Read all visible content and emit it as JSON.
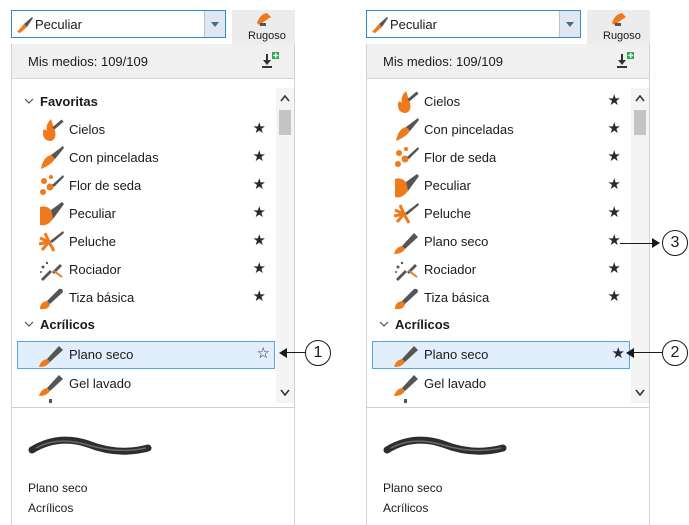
{
  "left": {
    "dropdown": "Peculiar",
    "next_tab": "Rugoso",
    "media_count": "Mis medios: 109/109",
    "groups": [
      {
        "label": "Favoritas",
        "items": [
          {
            "label": "Cielos",
            "icon": "brush-cielos",
            "starred": "★"
          },
          {
            "label": "Con pinceladas",
            "icon": "brush-pinceladas",
            "starred": "★"
          },
          {
            "label": "Flor de seda",
            "icon": "brush-flor",
            "starred": "★"
          },
          {
            "label": "Peculiar",
            "icon": "brush-peculiar",
            "starred": "★"
          },
          {
            "label": "Peluche",
            "icon": "brush-peluche",
            "starred": "★"
          },
          {
            "label": "Rociador",
            "icon": "brush-rociador",
            "starred": "★"
          },
          {
            "label": "Tiza básica",
            "icon": "brush-tiza",
            "starred": "★"
          }
        ]
      },
      {
        "label": "Acrílicos",
        "items": [
          {
            "label": "Plano seco",
            "icon": "brush-plano",
            "starred": "☆",
            "selected": true
          },
          {
            "label": "Gel lavado",
            "icon": "brush-gel",
            "starred": ""
          }
        ]
      }
    ],
    "info_name": "Plano seco",
    "info_category": "Acrílicos",
    "callout": "1"
  },
  "right": {
    "dropdown": "Peculiar",
    "next_tab": "Rugoso",
    "media_count": "Mis medios: 109/109",
    "groups": [
      {
        "label": "",
        "items": [
          {
            "label": "Cielos",
            "icon": "brush-cielos",
            "starred": "★"
          },
          {
            "label": "Con pinceladas",
            "icon": "brush-pinceladas",
            "starred": "★"
          },
          {
            "label": "Flor de seda",
            "icon": "brush-flor",
            "starred": "★"
          },
          {
            "label": "Peculiar",
            "icon": "brush-peculiar",
            "starred": "★"
          },
          {
            "label": "Peluche",
            "icon": "brush-peluche",
            "starred": "★"
          },
          {
            "label": "Plano seco",
            "icon": "brush-plano",
            "starred": "★"
          },
          {
            "label": "Rociador",
            "icon": "brush-rociador",
            "starred": "★"
          },
          {
            "label": "Tiza básica",
            "icon": "brush-tiza",
            "starred": "★"
          }
        ]
      },
      {
        "label": "Acrílicos",
        "items": [
          {
            "label": "Plano seco",
            "icon": "brush-plano",
            "starred": "★",
            "selected": true
          },
          {
            "label": "Gel lavado",
            "icon": "brush-gel",
            "starred": ""
          }
        ]
      }
    ],
    "info_name": "Plano seco",
    "info_category": "Acrílicos",
    "callout_star": "3",
    "callout_selected": "2"
  },
  "colors": {
    "accent": "#2b8bd0",
    "brush_orange": "#f07a1a",
    "brush_gray": "#555555"
  }
}
